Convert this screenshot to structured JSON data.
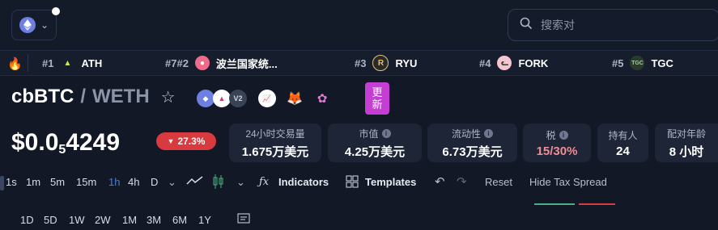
{
  "topbar": {
    "chain_icon": "ethereum-icon",
    "search": {
      "placeholder": "搜索对"
    }
  },
  "trending": [
    {
      "rank": "#1",
      "name": "ATH",
      "icon": "aethir-logo",
      "color": "#c6f04b"
    },
    {
      "rank": "#7#2",
      "name": "波兰国家统...",
      "icon": "token-avatar",
      "color": "#f06a8a"
    },
    {
      "rank": "#3",
      "name": "RYU",
      "icon": "ryu-logo",
      "color": "#e0c080"
    },
    {
      "rank": "#4",
      "name": "FORK",
      "icon": "fork-cat-avatar",
      "color": "#f5c6d0"
    },
    {
      "rank": "#5",
      "name": "TGC",
      "icon": "tgc-logo",
      "color": "#3a5a3a"
    }
  ],
  "pair": {
    "base": "cbBTC",
    "separator": "/",
    "quote": "WETH",
    "version": "V2",
    "update_label": [
      "更",
      "新"
    ]
  },
  "price": {
    "prefix": "$0.0",
    "zeros": "5",
    "digits": "4249",
    "change": "27.3%",
    "change_color": "#d83a3f"
  },
  "stats": [
    {
      "label": "24小时交易量",
      "value": "1.675万美元",
      "info": false
    },
    {
      "label": "市值",
      "value": "4.25万美元",
      "info": true
    },
    {
      "label": "流动性",
      "value": "6.73万美元",
      "info": true
    },
    {
      "label": "税",
      "value": "15/30%",
      "info": true
    },
    {
      "label": "持有人",
      "value": "24",
      "info": false
    },
    {
      "label": "配对年龄",
      "value": "8 小时",
      "info": false
    }
  ],
  "toolbar": {
    "intervals": [
      "1s",
      "1m",
      "5m",
      "15m",
      "1h",
      "4h",
      "D"
    ],
    "active_interval": "1h",
    "indicators": "Indicators",
    "templates": "Templates",
    "reset": "Reset",
    "hide_tax": "Hide Tax Spread"
  },
  "ranges": [
    "1D",
    "5D",
    "1W",
    "2W",
    "1M",
    "3M",
    "6M",
    "1Y"
  ]
}
